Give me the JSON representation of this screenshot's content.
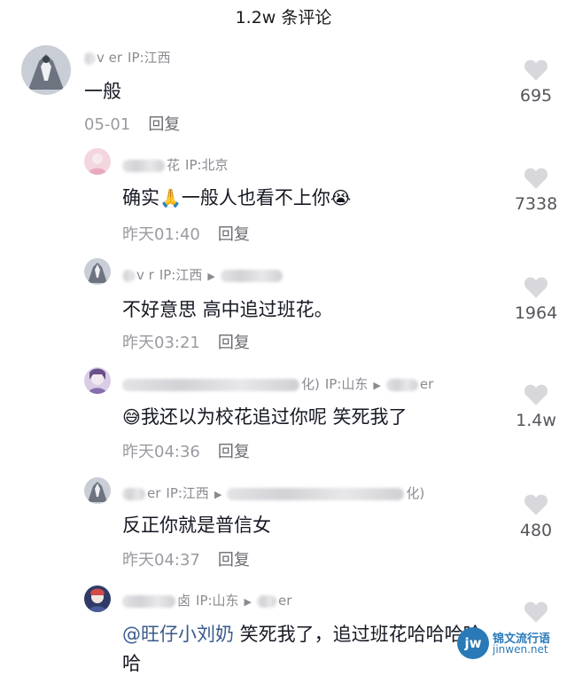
{
  "header": {
    "title": "1.2w 条评论"
  },
  "comments": [
    {
      "name": "v  er",
      "ip": "IP:江西",
      "target": "",
      "text": "一般",
      "time": "05-01",
      "reply_label": "回复",
      "likes": "695"
    },
    {
      "name": "花",
      "ip": "IP:北京",
      "target": "",
      "text_a": "确实",
      "emoji_a": "🙏",
      "text_b": "一般人也看不上你",
      "emoji_b": "😭",
      "time": "昨天01:40",
      "reply_label": "回复",
      "likes": "7338"
    },
    {
      "name": "v  r",
      "ip": "IP:江西",
      "target": "",
      "text": "不好意思 高中追过班花。",
      "time": "昨天03:21",
      "reply_label": "回复",
      "likes": "1964"
    },
    {
      "name": "化)",
      "ip": "IP:山东",
      "target": "er",
      "emoji_a": "😅",
      "text": "我还以为校花追过你呢 笑死我了",
      "time": "昨天04:36",
      "reply_label": "回复",
      "likes": "1.4w"
    },
    {
      "name": "er",
      "ip": "IP:江西",
      "target": "化)",
      "text": "反正你就是普信女",
      "time": "昨天04:37",
      "reply_label": "回复",
      "likes": "480"
    },
    {
      "name": "卤",
      "ip": "IP:山东",
      "target": "er",
      "mention": "@旺仔小刘奶",
      "text": " 笑死我了，追过班花哈哈哈哈",
      "text_line2": "哈",
      "likes": ""
    }
  ],
  "watermark": {
    "line1": "锦文流行语",
    "line2": "jinwen.net",
    "logo": "jw"
  },
  "icons": {
    "like": "heart-icon",
    "reply_arrow": "triangle-right-icon"
  },
  "colors": {
    "meta": "#8a8b91",
    "mention": "#3a5a8c",
    "heart": "#d8d8dc"
  }
}
